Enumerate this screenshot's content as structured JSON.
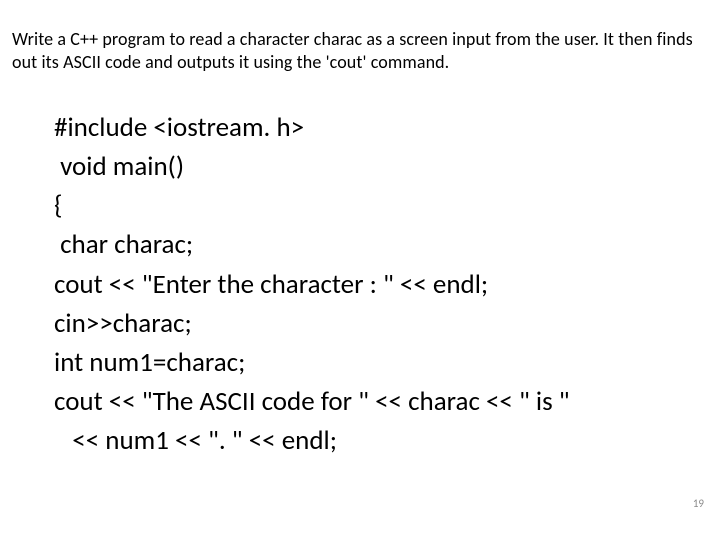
{
  "prompt": "Write a C++ program to read a character charac as a screen input from the user. It then finds out its ASCII code and outputs it using the 'cout' command.",
  "code": {
    "lines": [
      "#include <iostream. h>",
      " void main()",
      "{",
      " char charac;",
      "cout << \"Enter the character : \" << endl;",
      "cin>>charac;",
      "int num1=charac;",
      "cout << \"The ASCII code for \" << charac << \" is \"",
      "   << num1 << \". \" << endl;"
    ]
  },
  "page_number": "19"
}
